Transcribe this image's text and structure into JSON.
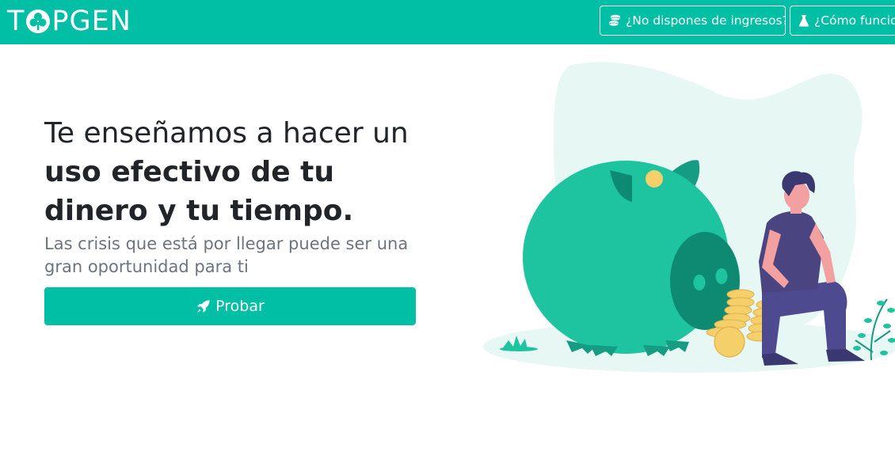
{
  "brand": {
    "name_before": "T",
    "name_after": "PGEN",
    "logo_icon": "clover-icon"
  },
  "nav": {
    "income_button": {
      "label": "¿No dispones de ingresos?",
      "icon": "coins-icon"
    },
    "how_button": {
      "label": "¿Cómo funcio",
      "icon": "flask-icon"
    }
  },
  "hero": {
    "headline_line1": "Te enseñamos a hacer un",
    "headline_line2": "uso efectivo de tu",
    "headline_line3": "dinero y tu tiempo.",
    "subtitle": "Las crisis que está por llegar puede ser una gran oportunidad para ti",
    "cta_label": "Probar",
    "cta_icon": "rocket-icon"
  },
  "colors": {
    "brand": "#00bfa5",
    "piggy": "#1ec4a0",
    "coin": "#f5cf6a",
    "person_shirt": "#4a4580",
    "skin": "#f3a0a0"
  }
}
